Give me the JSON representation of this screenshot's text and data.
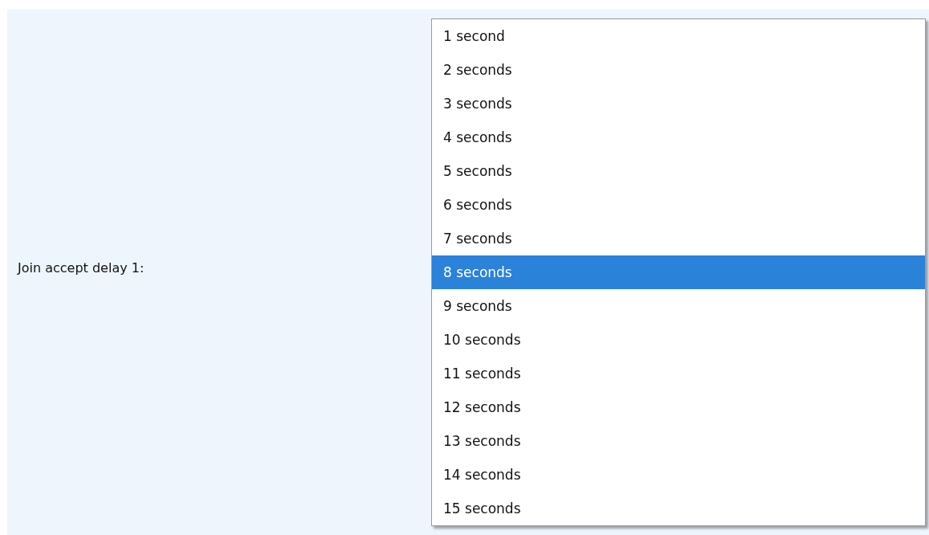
{
  "field": {
    "label": "Join accept delay 1:"
  },
  "dropdown": {
    "options": [
      {
        "label": "1 second",
        "selected": false
      },
      {
        "label": "2 seconds",
        "selected": false
      },
      {
        "label": "3 seconds",
        "selected": false
      },
      {
        "label": "4 seconds",
        "selected": false
      },
      {
        "label": "5 seconds",
        "selected": false
      },
      {
        "label": "6 seconds",
        "selected": false
      },
      {
        "label": "7 seconds",
        "selected": false
      },
      {
        "label": "8 seconds",
        "selected": true
      },
      {
        "label": "9 seconds",
        "selected": false
      },
      {
        "label": "10 seconds",
        "selected": false
      },
      {
        "label": "11 seconds",
        "selected": false
      },
      {
        "label": "12 seconds",
        "selected": false
      },
      {
        "label": "13 seconds",
        "selected": false
      },
      {
        "label": "14 seconds",
        "selected": false
      },
      {
        "label": "15 seconds",
        "selected": false
      }
    ]
  }
}
